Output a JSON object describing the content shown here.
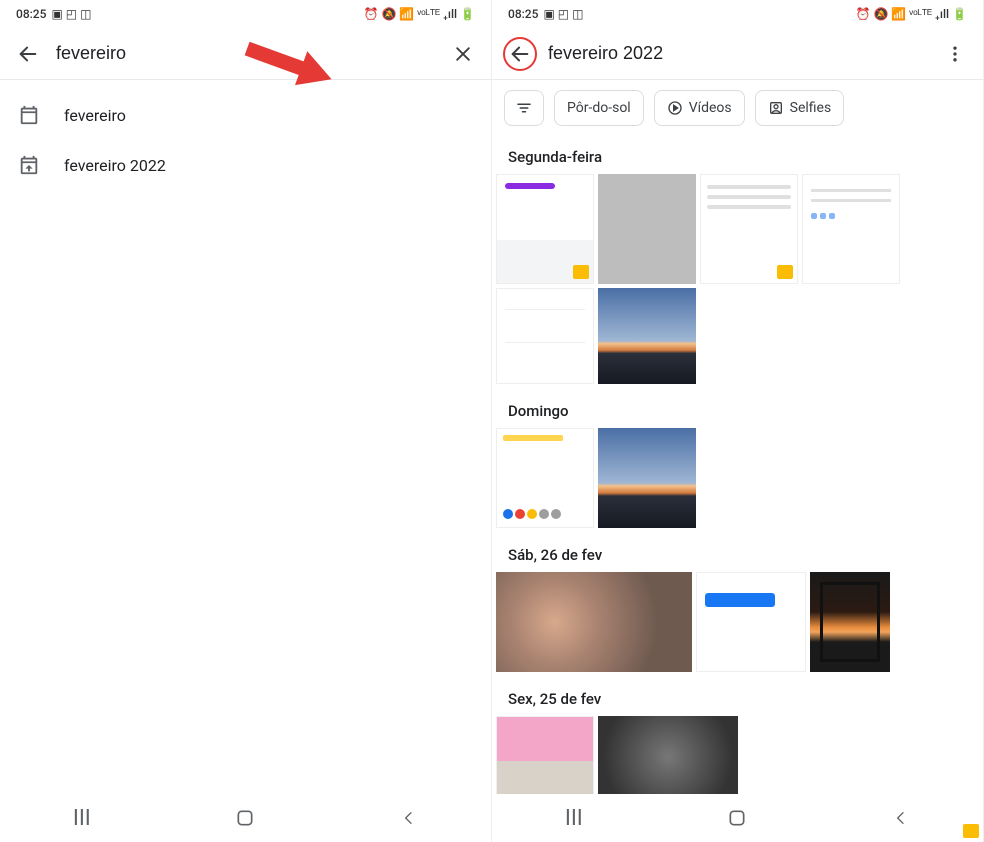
{
  "left": {
    "status": {
      "time": "08:25",
      "left_icons": "▣ ◰ ◫",
      "right_icons": "⏰ 🔕 📶 ᵛᵒᴸᵀᴱ ₊ıll 🔋"
    },
    "search": {
      "query": "fevereiro"
    },
    "suggestions": [
      {
        "label": "fevereiro"
      },
      {
        "label": "fevereiro 2022"
      }
    ]
  },
  "right": {
    "status": {
      "time": "08:25",
      "left_icons": "▣ ◰ ◫",
      "right_icons": "⏰ 🔕 📶 ᵛᵒᴸᵀᴱ ₊ıll 🔋"
    },
    "search": {
      "query": "fevereiro 2022"
    },
    "chips": [
      {
        "label": "Pôr-do-sol"
      },
      {
        "label": "Vídeos"
      },
      {
        "label": "Selfies"
      }
    ],
    "groups": [
      {
        "title": "Segunda-feira"
      },
      {
        "title": "Domingo"
      },
      {
        "title": "Sáb, 26 de fev"
      },
      {
        "title": "Sex, 25 de fev"
      }
    ]
  }
}
